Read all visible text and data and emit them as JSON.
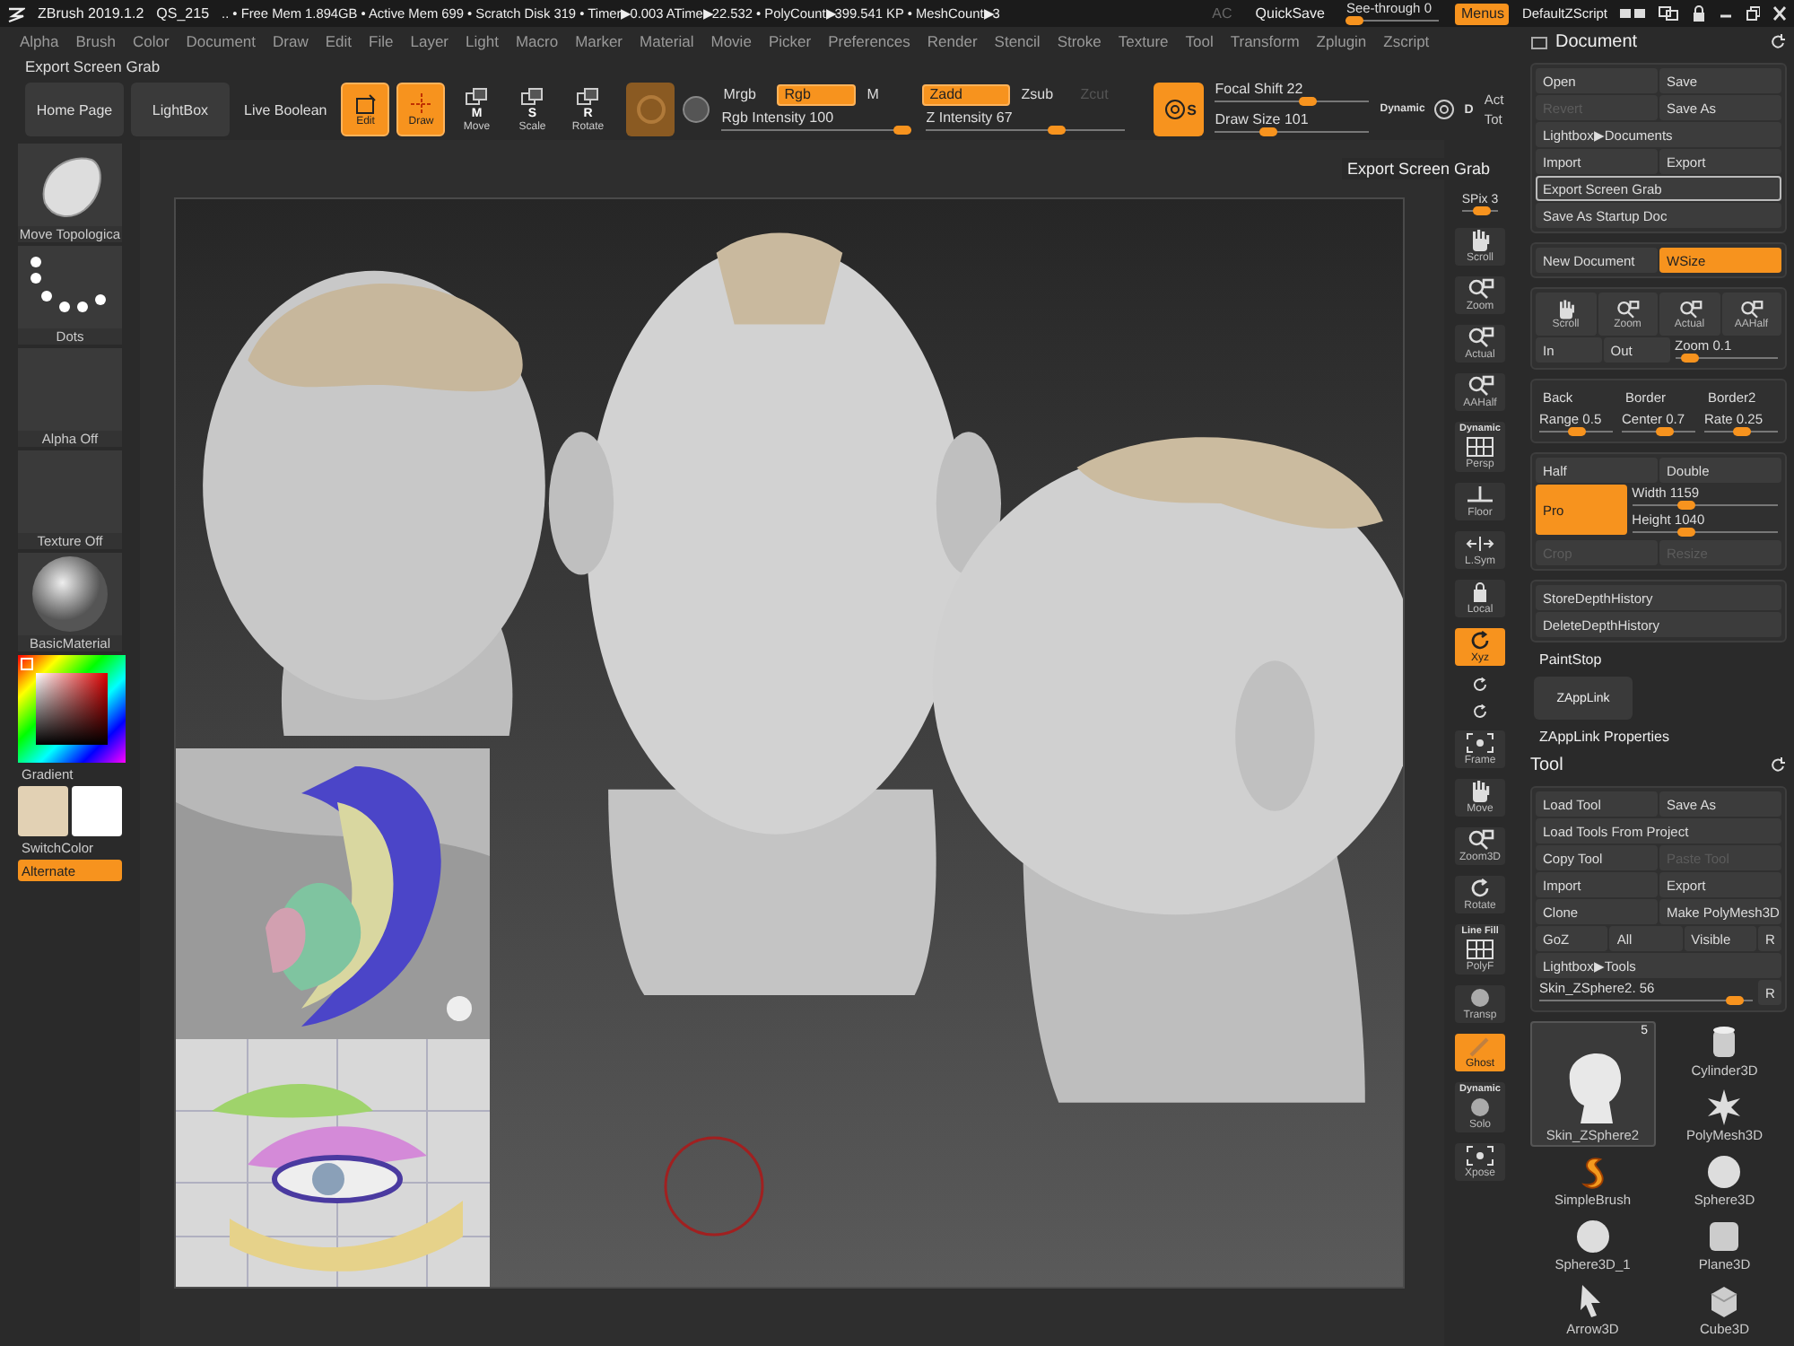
{
  "title_bar": {
    "app": "ZBrush 2019.1.2",
    "project": "QS_215",
    "stats": ".. • Free Mem 1.894GB • Active Mem 699 • Scratch Disk 319 • Timer▶0.003 ATime▶22.532 • PolyCount▶399.541 KP • MeshCount▶3",
    "buttons": [
      {
        "label": "AC",
        "disabled": true
      },
      {
        "label": "QuickSave",
        "disabled": false
      }
    ],
    "see_through": {
      "label": "See-through  0",
      "level": 0
    },
    "menus": {
      "label": "Menus",
      "on": true
    },
    "script": "DefaultZScript"
  },
  "menu": [
    "Alpha",
    "Brush",
    "Color",
    "Document",
    "Draw",
    "Edit",
    "File",
    "Layer",
    "Light",
    "Macro",
    "Marker",
    "Material",
    "Movie",
    "Picker",
    "Preferences",
    "Render",
    "Stencil",
    "Stroke",
    "Texture",
    "Tool",
    "Transform",
    "Zplugin",
    "Zscript"
  ],
  "palette_title": "Export Screen Grab",
  "shelf": {
    "links": [
      "Home Page",
      "LightBox",
      "Live Boolean"
    ],
    "tools": [
      {
        "kind": "edit",
        "label": "Edit",
        "on": true
      },
      {
        "kind": "draw",
        "label": "Draw",
        "on": true
      },
      {
        "kind": "move",
        "label": "Move",
        "badge": "M",
        "on": false
      },
      {
        "kind": "scale",
        "label": "Scale",
        "badge": "S",
        "on": false
      },
      {
        "kind": "rotate",
        "label": "Rotate",
        "badge": "R",
        "on": false
      }
    ],
    "channels": [
      {
        "label": "Mrgb",
        "on": false
      },
      {
        "label": "Rgb",
        "on": true
      },
      {
        "label": "M",
        "on": false
      }
    ],
    "rgb_intensity": {
      "label": "Rgb Intensity 100",
      "level": 1
    },
    "modes": [
      {
        "label": "Zadd",
        "on": true,
        "disabled": false
      },
      {
        "label": "Zsub",
        "on": false,
        "disabled": false
      },
      {
        "label": "Zcut",
        "on": false,
        "disabled": true
      }
    ],
    "z_intensity": {
      "label": "Z Intensity 67",
      "level": 0.67
    },
    "brush_badge": "S",
    "focal_shift": {
      "label": "Focal Shift 22",
      "level": 0.61
    },
    "draw_size": {
      "label": "Draw Size 101",
      "level": 0.33
    },
    "dynamic": "Dynamic",
    "alpha_badge": "D",
    "activity": [
      "Act",
      "Tot"
    ]
  },
  "left_shelf": {
    "items": [
      {
        "kind": "brush",
        "label": "Move Topologica"
      },
      {
        "kind": "stroke",
        "label": "Dots"
      },
      {
        "kind": "alpha",
        "label": "Alpha Off"
      },
      {
        "kind": "texture",
        "label": "Texture Off"
      },
      {
        "kind": "material",
        "label": "BasicMaterial"
      }
    ],
    "gradient": "Gradient",
    "colors": [
      {
        "color": "#e2d1b4"
      },
      {
        "color": "#ffffff"
      }
    ],
    "switch_color": "SwitchColor",
    "alternate": {
      "label": "Alternate",
      "on": true
    }
  },
  "tooltip": "Export Screen Grab",
  "right_shelf": {
    "spix": {
      "label": "SPix 3",
      "level": 0.6
    },
    "items": [
      {
        "kind": "scroll",
        "label": "Scroll",
        "on": false
      },
      {
        "kind": "zoom",
        "label": "Zoom",
        "on": false
      },
      {
        "kind": "actual",
        "label": "Actual",
        "on": false
      },
      {
        "kind": "aahalf",
        "label": "AAHalf",
        "on": false
      },
      {
        "kind": "persp",
        "top": "Dynamic",
        "label": "Persp",
        "on": false
      },
      {
        "kind": "floor",
        "label": "Floor",
        "on": false
      },
      {
        "kind": "lsym",
        "label": "L.Sym",
        "on": false
      },
      {
        "kind": "local",
        "label": "Local",
        "on": false
      },
      {
        "kind": "xyz",
        "label": "Xyz",
        "on": true
      },
      {
        "kind": "frame",
        "label": "Frame",
        "on": false
      },
      {
        "kind": "move",
        "label": "Move",
        "on": false
      },
      {
        "kind": "zoom3d",
        "label": "Zoom3D",
        "on": false
      },
      {
        "kind": "rotate",
        "label": "Rotate",
        "on": false
      },
      {
        "kind": "polyf",
        "top": "Line Fill",
        "label": "PolyF",
        "on": false
      },
      {
        "kind": "transp",
        "label": "Transp",
        "on": false
      },
      {
        "kind": "ghost",
        "label": "Ghost",
        "on": true
      },
      {
        "kind": "solo",
        "top": "Dynamic",
        "label": "Solo",
        "on": false
      },
      {
        "kind": "xpose",
        "label": "Xpose",
        "on": false
      }
    ]
  },
  "document_panel": {
    "title": "Document",
    "groups": [
      {
        "rows": [
          [
            {
              "kind": "button",
              "label": "Open"
            },
            {
              "kind": "button",
              "label": "Save"
            }
          ],
          [
            {
              "kind": "button",
              "label": "Revert",
              "disabled": true
            },
            {
              "kind": "button",
              "label": "Save As"
            }
          ],
          [
            {
              "kind": "button",
              "label": "Lightbox▶Documents"
            }
          ],
          [
            {
              "kind": "button",
              "label": "Import"
            },
            {
              "kind": "button",
              "label": "Export"
            }
          ],
          [
            {
              "kind": "button",
              "label": "Export Screen Grab",
              "highlighted": true
            }
          ],
          [
            {
              "kind": "button",
              "label": "Save As Startup Doc"
            }
          ]
        ]
      },
      {
        "rows": [
          [
            {
              "kind": "button",
              "label": "New Document"
            },
            {
              "kind": "toggle",
              "label": "WSize",
              "on": true
            }
          ]
        ]
      },
      {
        "rows": [
          [
            {
              "kind": "icon",
              "label": "Scroll"
            },
            {
              "kind": "icon",
              "label": "Zoom"
            },
            {
              "kind": "icon",
              "label": "Actual"
            },
            {
              "kind": "icon",
              "label": "AAHalf"
            }
          ],
          [
            {
              "kind": "button",
              "label": "In"
            },
            {
              "kind": "button",
              "label": "Out"
            },
            {
              "kind": "slider",
              "label": "Zoom 0.1",
              "level": 0.07
            }
          ]
        ]
      },
      {
        "rows": [
          [
            {
              "kind": "flat",
              "label": "Back"
            },
            {
              "kind": "flat",
              "label": "Border"
            },
            {
              "kind": "flat",
              "label": "Border2"
            }
          ],
          [
            {
              "kind": "slider",
              "label": "Range 0.5",
              "level": 0.5
            },
            {
              "kind": "slider",
              "label": "Center 0.7",
              "level": 0.6
            },
            {
              "kind": "slider",
              "label": "Rate 0.25",
              "level": 0.5
            }
          ]
        ]
      },
      {
        "rows": [
          [
            {
              "kind": "button",
              "label": "Half"
            },
            {
              "kind": "button",
              "label": "Double"
            }
          ],
          [
            {
              "kind": "toggle",
              "label": "Pro",
              "on": true
            },
            {
              "kind": "stack",
              "items": [
                {
                  "kind": "slider",
                  "label": "Width 1159",
                  "level": 0.35
                },
                {
                  "kind": "slider",
                  "label": "Height 1040",
                  "level": 0.35
                }
              ]
            }
          ],
          [
            {
              "kind": "button",
              "label": "Crop",
              "disabled": true
            },
            {
              "kind": "button",
              "label": "Resize",
              "disabled": true
            }
          ]
        ]
      },
      {
        "rows": [
          [
            {
              "kind": "button",
              "label": "StoreDepthHistory"
            }
          ],
          [
            {
              "kind": "button",
              "label": "DeleteDepthHistory"
            }
          ]
        ]
      }
    ]
  },
  "plugins": {
    "paint_stop": "PaintStop",
    "zapplink": "ZAppLink",
    "zapplink_properties": "ZAppLink Properties"
  },
  "tool_panel": {
    "title": "Tool",
    "groups": [
      {
        "rows": [
          [
            {
              "kind": "button",
              "label": "Load Tool"
            },
            {
              "kind": "button",
              "label": "Save As"
            }
          ],
          [
            {
              "kind": "button",
              "label": "Load Tools From Project"
            }
          ],
          [
            {
              "kind": "button",
              "label": "Copy Tool"
            },
            {
              "kind": "button",
              "label": "Paste Tool",
              "disabled": true
            }
          ],
          [
            {
              "kind": "button",
              "label": "Import"
            },
            {
              "kind": "button",
              "label": "Export"
            }
          ],
          [
            {
              "kind": "button",
              "label": "Clone"
            },
            {
              "kind": "button",
              "label": "Make PolyMesh3D"
            }
          ],
          [
            {
              "kind": "button",
              "label": "GoZ"
            },
            {
              "kind": "button",
              "label": "All"
            },
            {
              "kind": "button",
              "label": "Visible"
            },
            {
              "kind": "mini",
              "label": "R"
            }
          ],
          [
            {
              "kind": "button",
              "label": "Lightbox▶Tools"
            }
          ],
          [
            {
              "kind": "slider",
              "label": "Skin_ZSphere2. 56",
              "level": 0.95
            },
            {
              "kind": "mini",
              "label": "R"
            }
          ]
        ]
      }
    ],
    "tools": [
      {
        "kind": "head",
        "label": "Skin_ZSphere2",
        "count": "5",
        "selected": true
      },
      {
        "kind": "cylinder",
        "label": "Cylinder3D",
        "selected": false
      },
      {
        "kind": "star",
        "label": "PolyMesh3D",
        "selected": false
      },
      {
        "kind": "brush",
        "label": "SimpleBrush",
        "selected": false
      },
      {
        "kind": "sphere",
        "label": "Sphere3D",
        "selected": false
      },
      {
        "kind": "sphere",
        "label": "Sphere3D_1",
        "selected": false
      },
      {
        "kind": "plane",
        "label": "Plane3D",
        "selected": false
      },
      {
        "kind": "arrow",
        "label": "Arrow3D",
        "selected": false
      },
      {
        "kind": "cube",
        "label": "Cube3D",
        "selected": false
      }
    ]
  }
}
